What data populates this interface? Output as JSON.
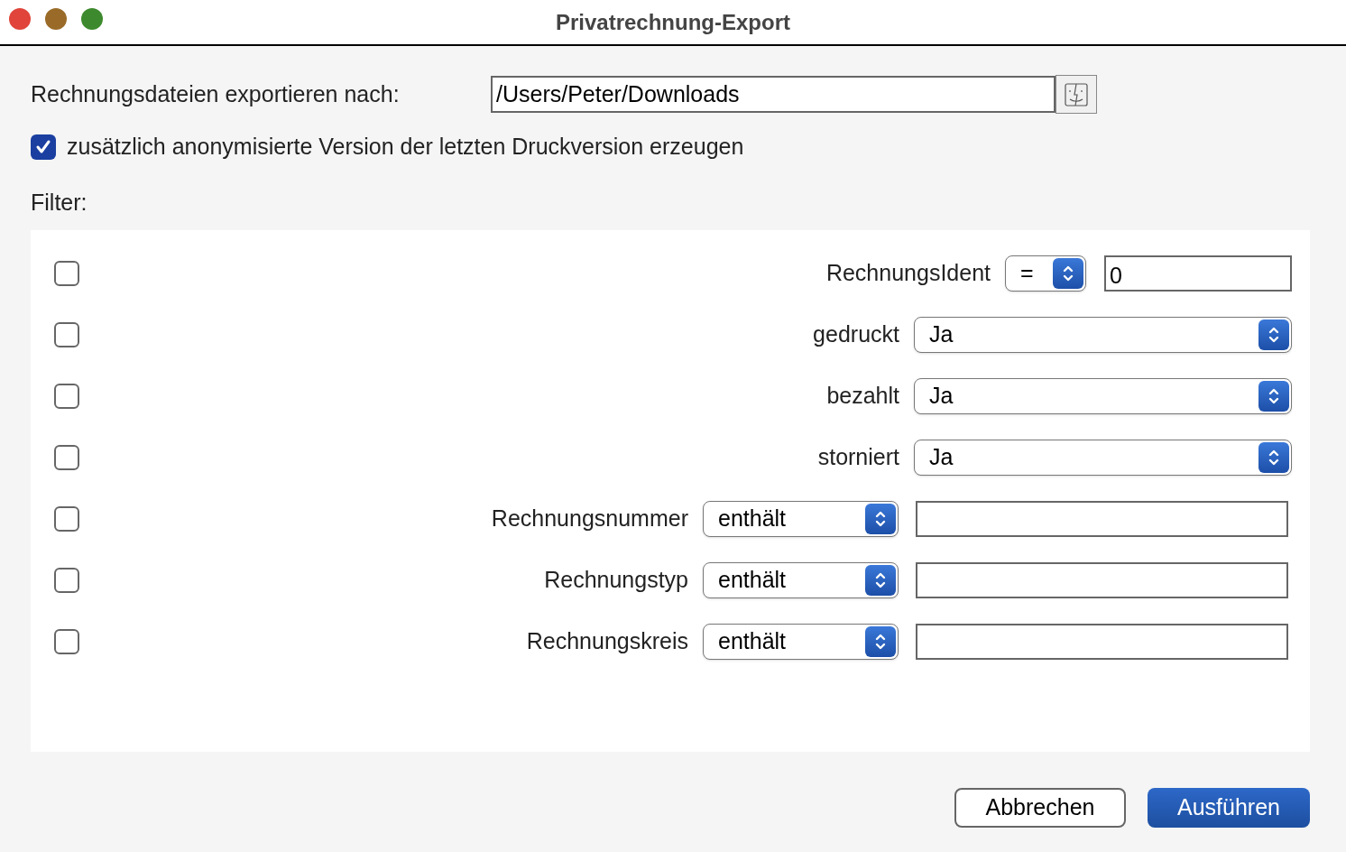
{
  "window": {
    "title": "Privatrechnung-Export"
  },
  "export": {
    "label": "Rechnungsdateien exportieren nach:",
    "path": "/Users/Peter/Downloads"
  },
  "anonymize": {
    "label": "zusätzlich anonymisierte Version der letzten Druckversion erzeugen",
    "checked": true
  },
  "filter": {
    "label": "Filter:",
    "rows": [
      {
        "kind": "short_op",
        "checked": false,
        "label": "RechnungsIdent",
        "operator": "=",
        "value": "0"
      },
      {
        "kind": "select",
        "checked": false,
        "label": "gedruckt",
        "value": "Ja"
      },
      {
        "kind": "select",
        "checked": false,
        "label": "bezahlt",
        "value": "Ja"
      },
      {
        "kind": "select",
        "checked": false,
        "label": "storniert",
        "value": "Ja"
      },
      {
        "kind": "wide_op",
        "checked": false,
        "label": "Rechnungsnummer",
        "operator": "enthält",
        "value": ""
      },
      {
        "kind": "wide_op",
        "checked": false,
        "label": "Rechnungstyp",
        "operator": "enthält",
        "value": ""
      },
      {
        "kind": "wide_op",
        "checked": false,
        "label": "Rechnungskreis",
        "operator": "enthält",
        "value": ""
      }
    ]
  },
  "buttons": {
    "cancel": "Abbrechen",
    "run": "Ausführen"
  }
}
